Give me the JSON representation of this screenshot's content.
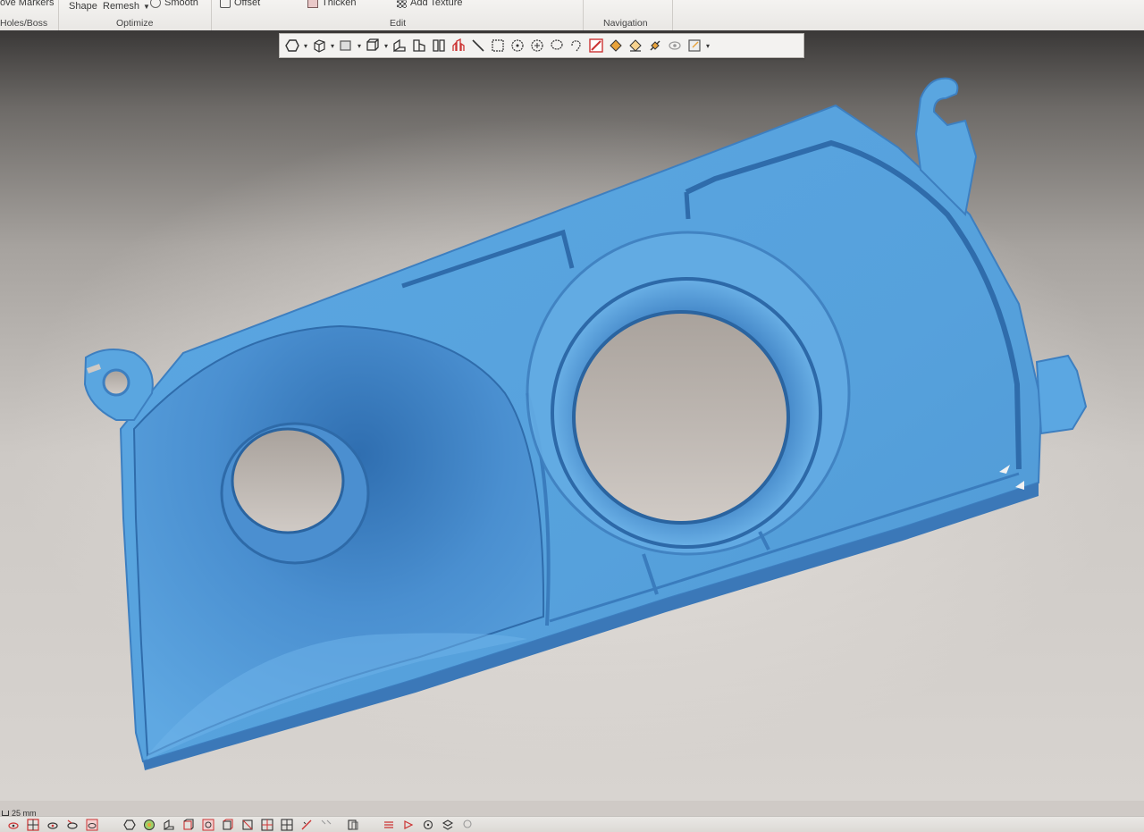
{
  "ribbon": {
    "tools": {
      "remove_markers": "ove Markers",
      "shape": "Shape",
      "remesh": "Remesh",
      "smooth": "Smooth",
      "offset": "Offset",
      "thicken": "Thicken",
      "add_texture": "Add Texture"
    },
    "groups": {
      "holes_boss": "Holes/Boss",
      "optimize": "Optimize",
      "edit": "Edit",
      "navigation": "Navigation"
    }
  },
  "viewport": {
    "model_color": "#5aa6e0",
    "scale_label": "25 mm"
  },
  "floating_toolbar": {
    "accent_red": "#d9333a",
    "accent_orange": "#e8a23a"
  }
}
